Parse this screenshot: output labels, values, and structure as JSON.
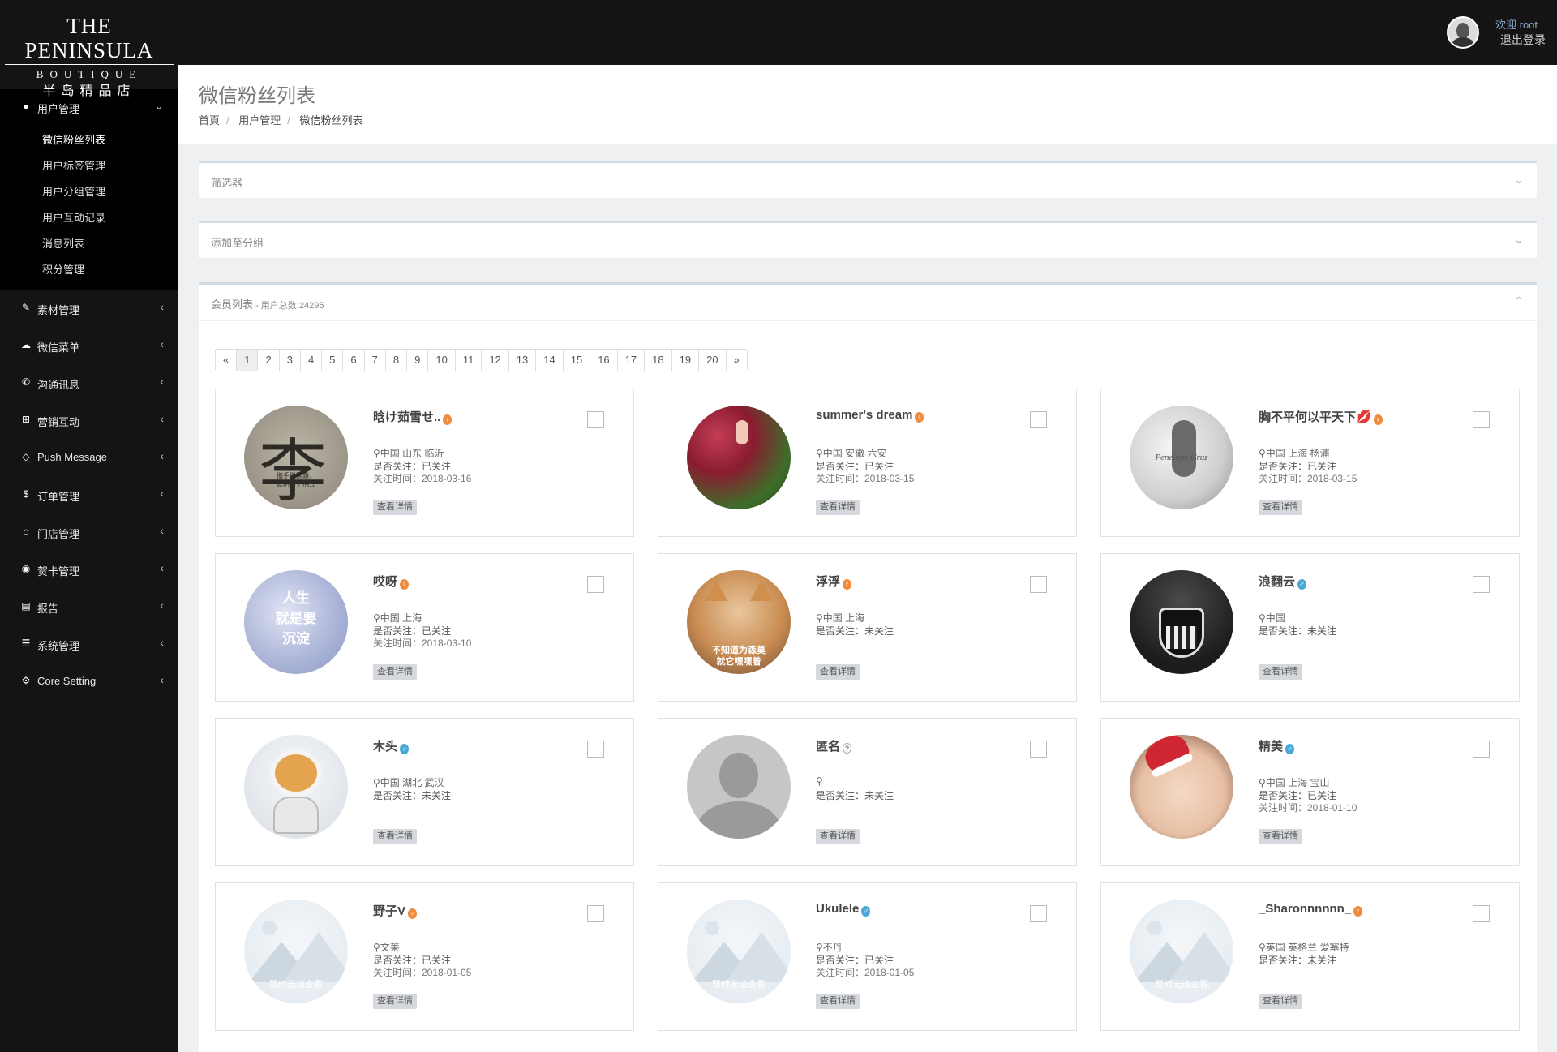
{
  "brand": {
    "line1": "THE PENINSULA",
    "line2": "BOUTIQUE",
    "line3": "半岛精品店"
  },
  "user": {
    "welcome": "欢迎 root",
    "logout": "退出登录"
  },
  "sidebar": {
    "open_menu": {
      "icon": "user-icon",
      "label": "用户管理",
      "items": [
        "微信粉丝列表",
        "用户标签管理",
        "用户分组管理",
        "用户互动记录",
        "消息列表",
        "积分管理"
      ]
    },
    "menus": [
      {
        "icon": "tag-icon",
        "glyph": "✎",
        "label": "素材管理"
      },
      {
        "icon": "comments-icon",
        "glyph": "☁",
        "label": "微信菜单"
      },
      {
        "icon": "phone-icon",
        "glyph": "✆",
        "label": "沟通讯息"
      },
      {
        "icon": "cart-icon",
        "glyph": "⊞",
        "label": "营销互动"
      },
      {
        "icon": "diamond-icon",
        "glyph": "◇",
        "label": "Push Message"
      },
      {
        "icon": "dollar-icon",
        "glyph": "$",
        "label": "订单管理"
      },
      {
        "icon": "bank-icon",
        "glyph": "⌂",
        "label": "门店管理"
      },
      {
        "icon": "globe-icon",
        "glyph": "◉",
        "label": "贺卡管理"
      },
      {
        "icon": "book-icon",
        "glyph": "▤",
        "label": "报告"
      },
      {
        "icon": "list-icon",
        "glyph": "☰",
        "label": "系统管理"
      },
      {
        "icon": "gear-icon",
        "glyph": "⚙",
        "label": "Core Setting"
      }
    ]
  },
  "page": {
    "title": "微信粉丝列表",
    "breadcrumb": [
      "首頁",
      "用户管理",
      "微信粉丝列表"
    ]
  },
  "panels": {
    "filter": "筛选器",
    "add_group": "添加至分组",
    "members": "会员列表",
    "members_count": " - 用户总数:24295"
  },
  "pagination": [
    "«",
    "1",
    "2",
    "3",
    "4",
    "5",
    "6",
    "7",
    "8",
    "9",
    "10",
    "11",
    "12",
    "13",
    "14",
    "15",
    "16",
    "17",
    "18",
    "19",
    "20",
    "»"
  ],
  "pagination_active": 1,
  "detail_label": "查看详情",
  "fans": [
    {
      "name": "晗け茹雪せ..",
      "gender": "female",
      "loc": "中国 山东 临沂",
      "sub": "是否关注：已关注",
      "time": "关注时间：2018-03-16",
      "avatar": "li",
      "avatar_text": "李",
      "avatar_sub": "攜手與緊鎖，\n握柄树下柄豆"
    },
    {
      "name": "summer's dream",
      "gender": "female",
      "loc": "中国 安徽 六安",
      "sub": "是否关注：已关注",
      "time": "关注时间：2018-03-15",
      "avatar": "flowers"
    },
    {
      "name": "胸不平何以平天下💋",
      "gender": "female",
      "loc": "中国 上海 杨浦",
      "sub": "是否关注：已关注",
      "time": "关注时间：2018-03-15",
      "avatar": "bw",
      "avatar_text": "Penelope   Cruz"
    },
    {
      "name": "哎呀",
      "gender": "female",
      "loc": "中国 上海",
      "sub": "是否关注：已关注",
      "time": "关注时间：2018-03-10",
      "avatar": "haha",
      "avatar_text": "人生\n就是要\n沉淀"
    },
    {
      "name": "浮浮",
      "gender": "female",
      "loc": "中国 上海",
      "sub": "是否关注：未关注",
      "time": "",
      "avatar": "cat",
      "avatar_text": "不知道为森莫\n就它嘿嘿着"
    },
    {
      "name": "浪翻云",
      "gender": "male",
      "loc": "中国",
      "sub": "是否关注：未关注",
      "time": "",
      "avatar": "barca"
    },
    {
      "name": "木头",
      "gender": "male",
      "loc": "中国 湖北 武汉",
      "sub": "是否关注：未关注",
      "time": "",
      "avatar": "dog"
    },
    {
      "name": "匿名",
      "gender": "unknown",
      "loc": "",
      "sub": "是否关注：未关注",
      "time": "",
      "avatar": "default"
    },
    {
      "name": "精美",
      "gender": "male",
      "loc": "中国 上海 宝山",
      "sub": "是否关注：已关注",
      "time": "关注时间：2018-01-10",
      "avatar": "girl"
    },
    {
      "name": "野子V",
      "gender": "female",
      "loc": "文莱",
      "sub": "是否关注：已关注",
      "time": "关注时间：2018-01-05",
      "avatar": "na",
      "avatar_text": "暂时无法查看"
    },
    {
      "name": "Ukulele",
      "gender": "male",
      "loc": "不丹",
      "sub": "是否关注：已关注",
      "time": "关注时间：2018-01-05",
      "avatar": "na",
      "avatar_text": "暂时无法查看"
    },
    {
      "name": "_Sharonnnnnn_",
      "gender": "female",
      "loc": "英国 英格兰 爱塞特",
      "sub": "是否关注：未关注",
      "time": "",
      "avatar": "na",
      "avatar_text": "暂时无法查看"
    }
  ]
}
